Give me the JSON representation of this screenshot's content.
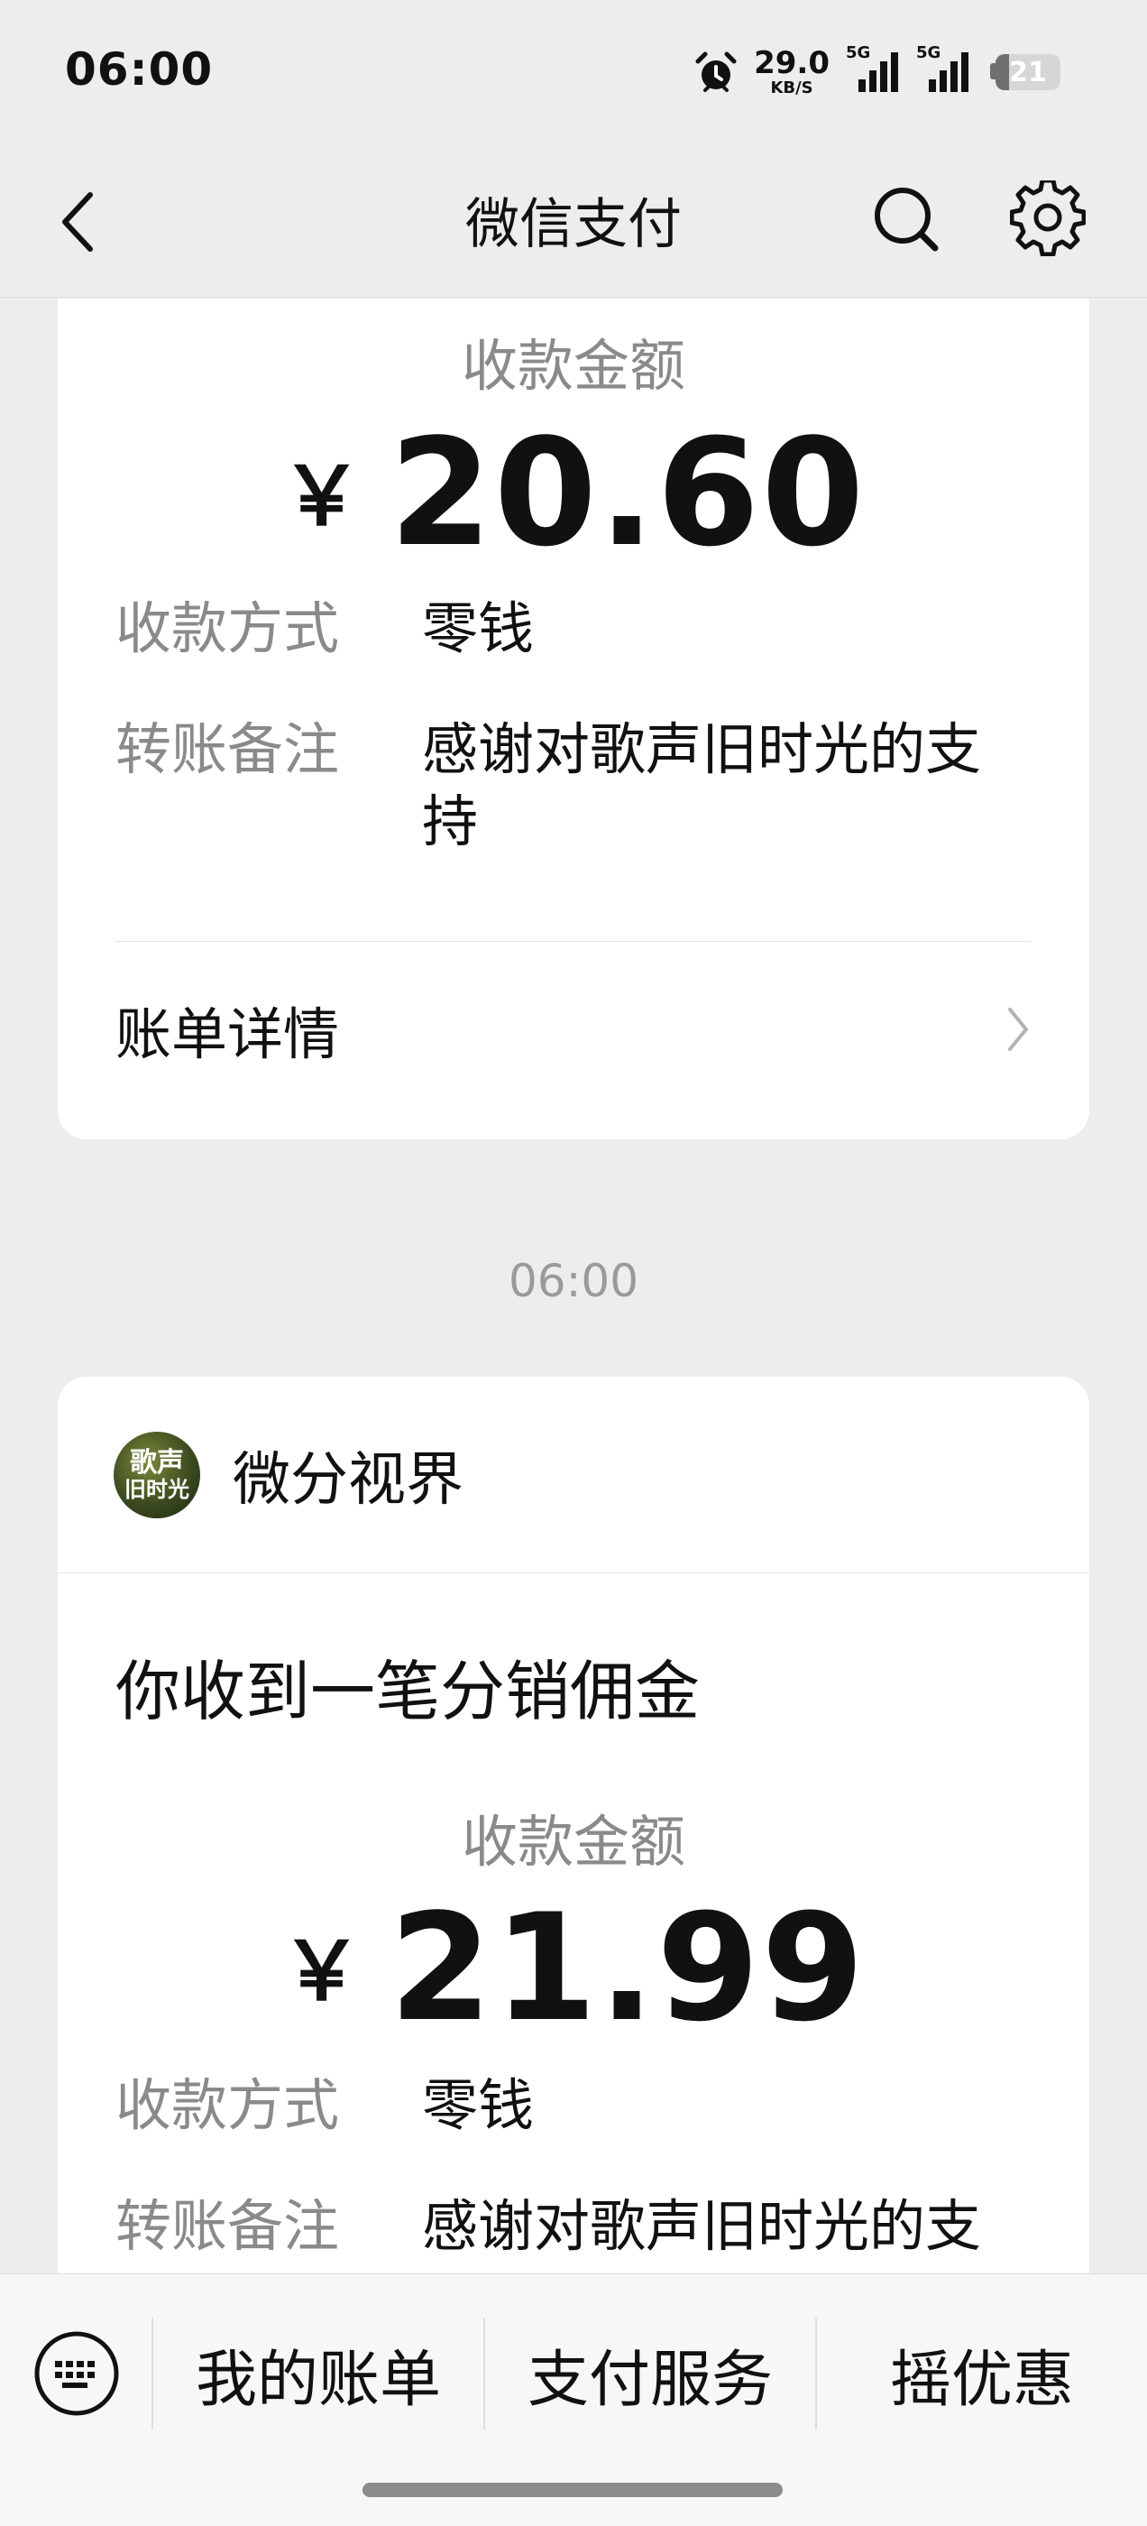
{
  "status_bar": {
    "time": "06:00",
    "net_speed_value": "29.0",
    "net_speed_unit": "KB/S",
    "signal_1_label": "5G",
    "signal_2_label": "5G",
    "battery_level": "21",
    "battery_fraction": 0.21
  },
  "nav": {
    "title": "微信支付",
    "back_icon": "chevron-left-icon",
    "search_icon": "search-icon",
    "settings_icon": "gear-icon"
  },
  "card1": {
    "amount_label": "收款金额",
    "currency": "￥",
    "amount": "20.60",
    "method_key": "收款方式",
    "method_value": "零钱",
    "note_key": "转账备注",
    "note_value": "感谢对歌声旧时光的支持",
    "bill_detail": "账单详情"
  },
  "time_stamp": "06:00",
  "card2": {
    "avatar_text_1": "歌声",
    "avatar_text_2": "旧时光",
    "merchant_name": "微分视界",
    "title": "你收到一笔分销佣金",
    "amount_label": "收款金额",
    "currency": "￥",
    "amount": "21.99",
    "method_key": "收款方式",
    "method_value": "零钱",
    "note_key": "转账备注",
    "note_value": "感谢对歌声旧时光的支"
  },
  "bottom_bar": {
    "keyboard_icon": "keyboard-icon",
    "tab1": "我的账单",
    "tab2": "支付服务",
    "tab3": "摇优惠"
  },
  "colors": {
    "background": "#ededed",
    "card": "#ffffff",
    "secondary_text": "#8a8a8a",
    "primary_text": "#111111"
  }
}
